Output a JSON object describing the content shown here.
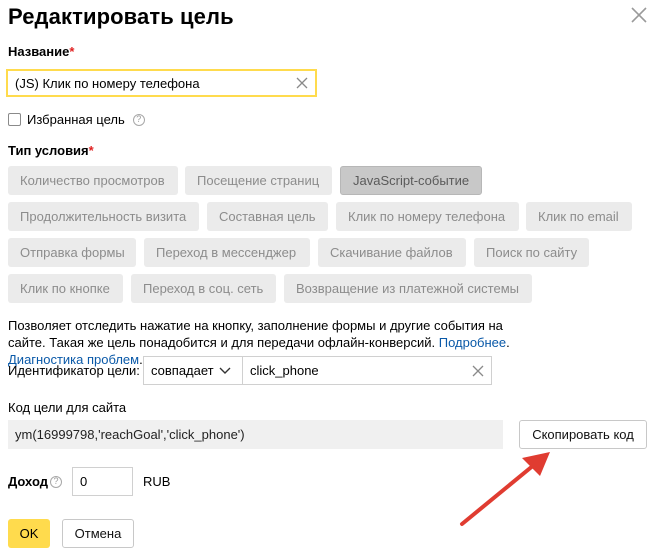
{
  "dialog": {
    "title": "Редактировать цель"
  },
  "name_field": {
    "label": "Название",
    "required_mark": "*",
    "value": "(JS) Клик по номеру телефона"
  },
  "favorite": {
    "label": "Избранная цель",
    "help": "?",
    "checked": false
  },
  "condition": {
    "label": "Тип условия",
    "required_mark": "*",
    "types": [
      "Количество просмотров",
      "Посещение страниц",
      "JavaScript-событие",
      "Продолжительность визита",
      "Составная цель",
      "Клик по номеру телефона",
      "Клик по email",
      "Отправка формы",
      "Переход в мессенджер",
      "Скачивание файлов",
      "Поиск по сайту",
      "Клик по кнопке",
      "Переход в соц. сеть",
      "Возвращение из платежной системы"
    ],
    "selected": "JavaScript-событие"
  },
  "description": {
    "text": "Позволяет отследить нажатие на кнопку, заполнение формы и другие события на сайте. Такая же цель понадобится и для передачи офлайн-конверсий. ",
    "more_link": "Подробнее",
    "sep": ". ",
    "diag_link": "Диагностика проблем",
    "end": "."
  },
  "identifier": {
    "label": "Идентификатор цели:",
    "match": "совпадает",
    "value": "click_phone"
  },
  "site_code": {
    "label": "Код цели для сайта",
    "code": "ym(16999798,'reachGoal','click_phone')",
    "copy_button": "Скопировать код"
  },
  "income": {
    "label": "Доход",
    "help": "?",
    "value": "0",
    "currency": "RUB"
  },
  "footer": {
    "ok": "OK",
    "cancel": "Отмена"
  },
  "colors": {
    "accent": "#ffdb4d",
    "link": "#0a59a8",
    "required": "#e02020",
    "arrow": "#e03c31"
  }
}
